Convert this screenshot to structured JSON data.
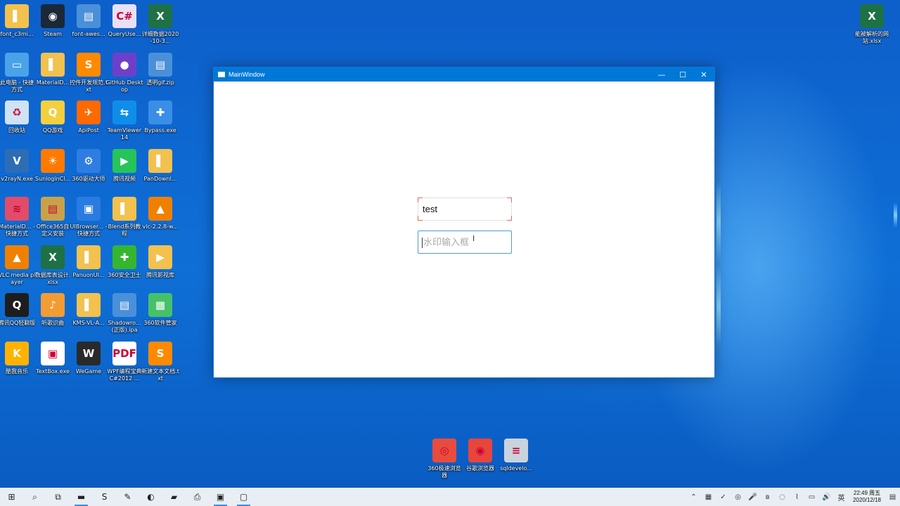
{
  "window": {
    "title": "MainWindow",
    "minimize_glyph": "—",
    "maximize_glyph": "☐",
    "close_glyph": "✕",
    "textbox_value": "test",
    "watermark_placeholder": "水印输入框"
  },
  "desktop_icons": [
    {
      "label": "font_c3mi...",
      "icon": "folder-icon",
      "color": "#f2c14e",
      "glyph": "▌"
    },
    {
      "label": "Steam",
      "icon": "steam-icon",
      "color": "#1b2838",
      "glyph": "◉"
    },
    {
      "label": "font-awes...",
      "icon": "archive-icon",
      "color": "#4a90d9",
      "glyph": "▤"
    },
    {
      "label": "QueryUse...",
      "icon": "vs-file-icon",
      "color": "#e9e0f5",
      "glyph": "C#"
    },
    {
      "label": "详细数据2020-10-3...",
      "icon": "excel-icon",
      "color": "#1e7145",
      "glyph": "X"
    },
    {
      "label": "此电脑 - 快捷方式",
      "icon": "this-pc-icon",
      "color": "#4aa3e8",
      "glyph": "▭"
    },
    {
      "label": "MaterialD...",
      "icon": "folder-icon",
      "color": "#f2c14e",
      "glyph": "▌"
    },
    {
      "label": "控件开发规范.txt",
      "icon": "sublime-icon",
      "color": "#ff8a00",
      "glyph": "S"
    },
    {
      "label": "GitHub Desktop",
      "icon": "github-icon",
      "color": "#6e40c9",
      "glyph": "●"
    },
    {
      "label": "透明gif.zip",
      "icon": "archive-icon",
      "color": "#4a90d9",
      "glyph": "▤"
    },
    {
      "label": "回收站",
      "icon": "recycle-bin-icon",
      "color": "#cfe3f5",
      "glyph": "♻"
    },
    {
      "label": "QQ游戏",
      "icon": "qq-game-icon",
      "color": "#f4d03f",
      "glyph": "Q"
    },
    {
      "label": "ApiPost",
      "icon": "apipost-icon",
      "color": "#ff6a00",
      "glyph": "✈"
    },
    {
      "label": "TeamViewer 14",
      "icon": "teamviewer-icon",
      "color": "#0e8ee9",
      "glyph": "⇆"
    },
    {
      "label": "Bypass.exe",
      "icon": "bypass-icon",
      "color": "#3a8ee6",
      "glyph": "✚"
    },
    {
      "label": "v2rayN.exe",
      "icon": "v2ray-icon",
      "color": "#2d6db5",
      "glyph": "V"
    },
    {
      "label": "SunloginCl...",
      "icon": "sunlogin-icon",
      "color": "#ff7a00",
      "glyph": "☀"
    },
    {
      "label": "360驱动大师",
      "icon": "driver-icon",
      "color": "#2f7de1",
      "glyph": "⚙"
    },
    {
      "label": "腾讯视频",
      "icon": "tencent-video-icon",
      "color": "#27c35b",
      "glyph": "▶"
    },
    {
      "label": "PanDownl...",
      "icon": "folder-icon",
      "color": "#f2c14e",
      "glyph": "▌"
    },
    {
      "label": "MaterialD... - 快捷方式",
      "icon": "layers-icon",
      "color": "#e24b6a",
      "glyph": "≋"
    },
    {
      "label": "Office365自定义安装",
      "icon": "archive-icon",
      "color": "#c8a24a",
      "glyph": "▤"
    },
    {
      "label": "UIBrowser... - 快捷方式",
      "icon": "window-app-icon",
      "color": "#2a7be0",
      "glyph": "▣"
    },
    {
      "label": "Blend系列教程",
      "icon": "folder-icon",
      "color": "#f2c14e",
      "glyph": "▌"
    },
    {
      "label": "vlc-2.2.8-w...",
      "icon": "vlc-icon",
      "color": "#f08000",
      "glyph": "▲"
    },
    {
      "label": "VLC media player",
      "icon": "vlc-icon",
      "color": "#f08000",
      "glyph": "▲"
    },
    {
      "label": "数据库表设计.xlsx",
      "icon": "excel-icon",
      "color": "#1e7145",
      "glyph": "X"
    },
    {
      "label": "PanuonUI...",
      "icon": "folder-icon",
      "color": "#f2c14e",
      "glyph": "▌"
    },
    {
      "label": "360安全卫士",
      "icon": "360-security-icon",
      "color": "#36b52f",
      "glyph": "✚"
    },
    {
      "label": "腾讯影视库",
      "icon": "folder-video-icon",
      "color": "#f2c14e",
      "glyph": "▶"
    },
    {
      "label": "腾讯QQ轻聊版",
      "icon": "qq-icon",
      "color": "#1d1d1d",
      "glyph": "Q"
    },
    {
      "label": "听歌识曲",
      "icon": "mic-icon",
      "color": "#f39c33",
      "glyph": "♪"
    },
    {
      "label": "KMS-VL-A...",
      "icon": "folder-icon",
      "color": "#f2c14e",
      "glyph": "▌"
    },
    {
      "label": "Shadowro... (正版).ipa",
      "icon": "archive-icon",
      "color": "#4a90d9",
      "glyph": "▤"
    },
    {
      "label": "360软件管家",
      "icon": "360-software-icon",
      "color": "#46c16a",
      "glyph": "▦"
    },
    {
      "label": "酷我音乐",
      "icon": "kuwo-icon",
      "color": "#ffb300",
      "glyph": "K"
    },
    {
      "label": "TextBox.exe",
      "icon": "window-app-icon",
      "color": "#ffffff",
      "glyph": "▣"
    },
    {
      "label": "WeGame",
      "icon": "wegame-icon",
      "color": "#2a2a2a",
      "glyph": "W"
    },
    {
      "label": "WPF编程宝典C#2012 ...",
      "icon": "pdf-icon",
      "color": "#ffffff",
      "glyph": "PDF"
    },
    {
      "label": "新建文本文档.txt",
      "icon": "sublime-icon",
      "color": "#ff8a00",
      "glyph": "S"
    }
  ],
  "right_icons": [
    {
      "label": "能被解析的网站.xlsx",
      "icon": "excel-icon",
      "color": "#1e7145",
      "glyph": "X"
    }
  ],
  "bottom_icons": [
    {
      "label": "360极速浏览器",
      "icon": "360-browser-icon",
      "color": "#e84c3d",
      "glyph": "◎"
    },
    {
      "label": "谷歌浏览器",
      "icon": "chrome-icon",
      "color": "#e8453c",
      "glyph": "◉"
    },
    {
      "label": "sqldevelo...",
      "icon": "database-icon",
      "color": "#c9d3dd",
      "glyph": "≡"
    }
  ],
  "taskbar": {
    "items": [
      {
        "name": "windows-start-icon",
        "glyph": "⊞",
        "active": false
      },
      {
        "name": "search-icon",
        "glyph": "⌕",
        "active": false
      },
      {
        "name": "task-view-icon",
        "glyph": "⧉",
        "active": false
      },
      {
        "name": "file-explorer-icon",
        "glyph": "▬",
        "active": true
      },
      {
        "name": "sublime-icon",
        "glyph": "S",
        "active": false
      },
      {
        "name": "pen-tool-icon",
        "glyph": "✎",
        "active": false
      },
      {
        "name": "gitkraken-icon",
        "glyph": "◐",
        "active": false
      },
      {
        "name": "app-red-icon",
        "glyph": "▰",
        "active": false
      },
      {
        "name": "printer-icon",
        "glyph": "⎙",
        "active": false
      },
      {
        "name": "wpf-app-icon",
        "glyph": "▣",
        "active": true
      },
      {
        "name": "window-app-icon",
        "glyph": "▢",
        "active": true
      }
    ],
    "tray": [
      "tray-app-icon",
      "tray-check-icon",
      "tray-360-icon",
      "mic-icon",
      "bluetooth-icon",
      "tray-red-icon",
      "wifi-icon",
      "network-icon",
      "volume-icon",
      "ime-icon"
    ],
    "tray_glyphs": [
      "▦",
      "✓",
      "◎",
      "🎤",
      "ʙ",
      "◌",
      "⌇",
      "▭",
      "🔊",
      "英"
    ],
    "time": "22:49 周五",
    "date": "2020/12/18",
    "notification_glyph": "▤"
  }
}
